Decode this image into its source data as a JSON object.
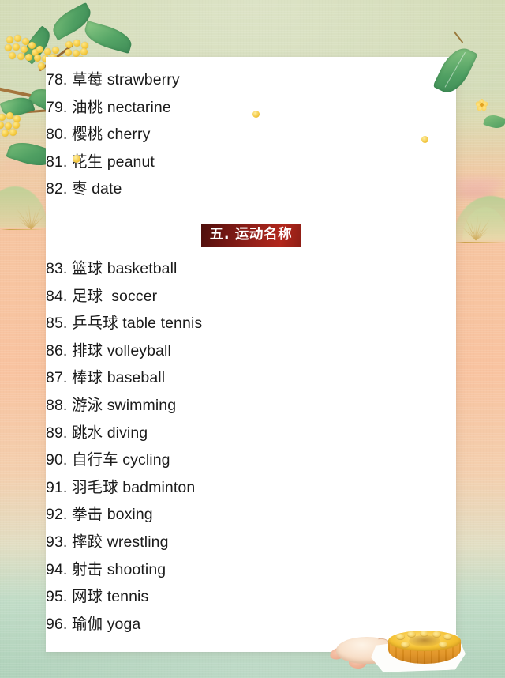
{
  "page": {
    "background_theme": "mid-autumn-osmanthus",
    "card_background": "#ffffff",
    "accent_banner_color": "#96211a",
    "text_color": "#1b1b1b"
  },
  "fruit_list": [
    {
      "num": "78.",
      "hanzi": "草莓",
      "english": "strawberry"
    },
    {
      "num": "79.",
      "hanzi": "油桃",
      "english": "nectarine"
    },
    {
      "num": "80.",
      "hanzi": "樱桃",
      "english": "cherry"
    },
    {
      "num": "81.",
      "hanzi": "花生",
      "english": "peanut"
    },
    {
      "num": "82.",
      "hanzi": "枣",
      "english": "date"
    }
  ],
  "section": {
    "label": "五. 运动名称"
  },
  "sport_list": [
    {
      "num": "83.",
      "hanzi": "篮球",
      "english": "basketball"
    },
    {
      "num": "84.",
      "hanzi": "足球",
      "english": "soccer"
    },
    {
      "num": "85.",
      "hanzi": "乒乓球",
      "english": "table tennis"
    },
    {
      "num": "86.",
      "hanzi": "排球",
      "english": "volleyball"
    },
    {
      "num": "87.",
      "hanzi": "棒球",
      "english": "baseball"
    },
    {
      "num": "88.",
      "hanzi": "游泳",
      "english": "swimming"
    },
    {
      "num": "89.",
      "hanzi": "跳水",
      "english": "diving"
    },
    {
      "num": "90.",
      "hanzi": "自行车",
      "english": "cycling"
    },
    {
      "num": "91.",
      "hanzi": "羽毛球",
      "english": "badminton"
    },
    {
      "num": "92.",
      "hanzi": "拳击",
      "english": "boxing"
    },
    {
      "num": "93.",
      "hanzi": "摔跤",
      "english": "wrestling"
    },
    {
      "num": "94.",
      "hanzi": "射击",
      "english": "shooting"
    },
    {
      "num": "95.",
      "hanzi": "网球",
      "english": "tennis"
    },
    {
      "num": "96.",
      "hanzi": "瑜伽",
      "english": "yoga"
    }
  ],
  "decorations": {
    "top_left": "osmanthus-branch",
    "top_right": "green-leaf",
    "right_margin": "green-hill-with-gold-rays",
    "bottom_right": "mooncake-on-napkin",
    "bottom_center_right": "peach-pastry"
  }
}
